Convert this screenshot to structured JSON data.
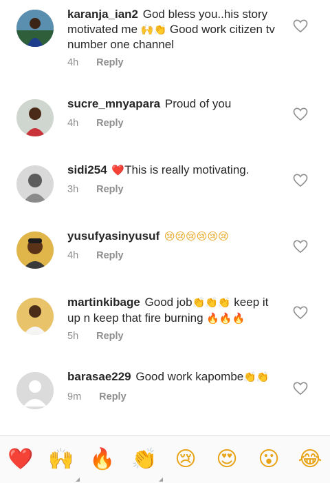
{
  "comments": [
    {
      "username": "karanja_ian2",
      "text_parts": [
        "God bless you..his story motivated me ",
        "🙌",
        "👏",
        " Good work citizen tv number one channel"
      ],
      "time": "4h",
      "reply": "Reply"
    },
    {
      "username": "sucre_mnyapara",
      "text_parts": [
        "Proud of you"
      ],
      "time": "4h",
      "reply": "Reply"
    },
    {
      "username": "sidi254",
      "text_parts": [
        "❤️",
        "This is really motivating."
      ],
      "time": "3h",
      "reply": "Reply"
    },
    {
      "username": "yusufyasinyusuf",
      "text_parts": [
        "😢😢😢😢😢😢"
      ],
      "time": "4h",
      "reply": "Reply"
    },
    {
      "username": "martinkibage",
      "text_parts": [
        "Good job",
        "👏👏👏",
        " keep it up n keep that fire burning ",
        "🔥🔥🔥"
      ],
      "time": "5h",
      "reply": "Reply"
    },
    {
      "username": "barasae229",
      "text_parts": [
        "Good work kapombe",
        "👏👏"
      ],
      "time": "9m",
      "reply": "Reply"
    }
  ],
  "emoji_bar": [
    {
      "glyph": "❤️",
      "name": "red-heart-emoji",
      "color": "#ed4956"
    },
    {
      "glyph": "🙌",
      "name": "raising-hands-emoji",
      "color": "#e8a317"
    },
    {
      "glyph": "🔥",
      "name": "fire-emoji",
      "color": "#f26a1b"
    },
    {
      "glyph": "👏",
      "name": "clapping-hands-emoji",
      "color": "#e8a317"
    },
    {
      "glyph": "😢",
      "name": "crying-face-emoji",
      "color": "#e8a317"
    },
    {
      "glyph": "😍",
      "name": "heart-eyes-emoji",
      "color": "#e8a317"
    },
    {
      "glyph": "😮",
      "name": "surprised-face-emoji",
      "color": "#e8a317"
    },
    {
      "glyph": "😂",
      "name": "tears-of-joy-emoji",
      "color": "#e8a317"
    }
  ]
}
